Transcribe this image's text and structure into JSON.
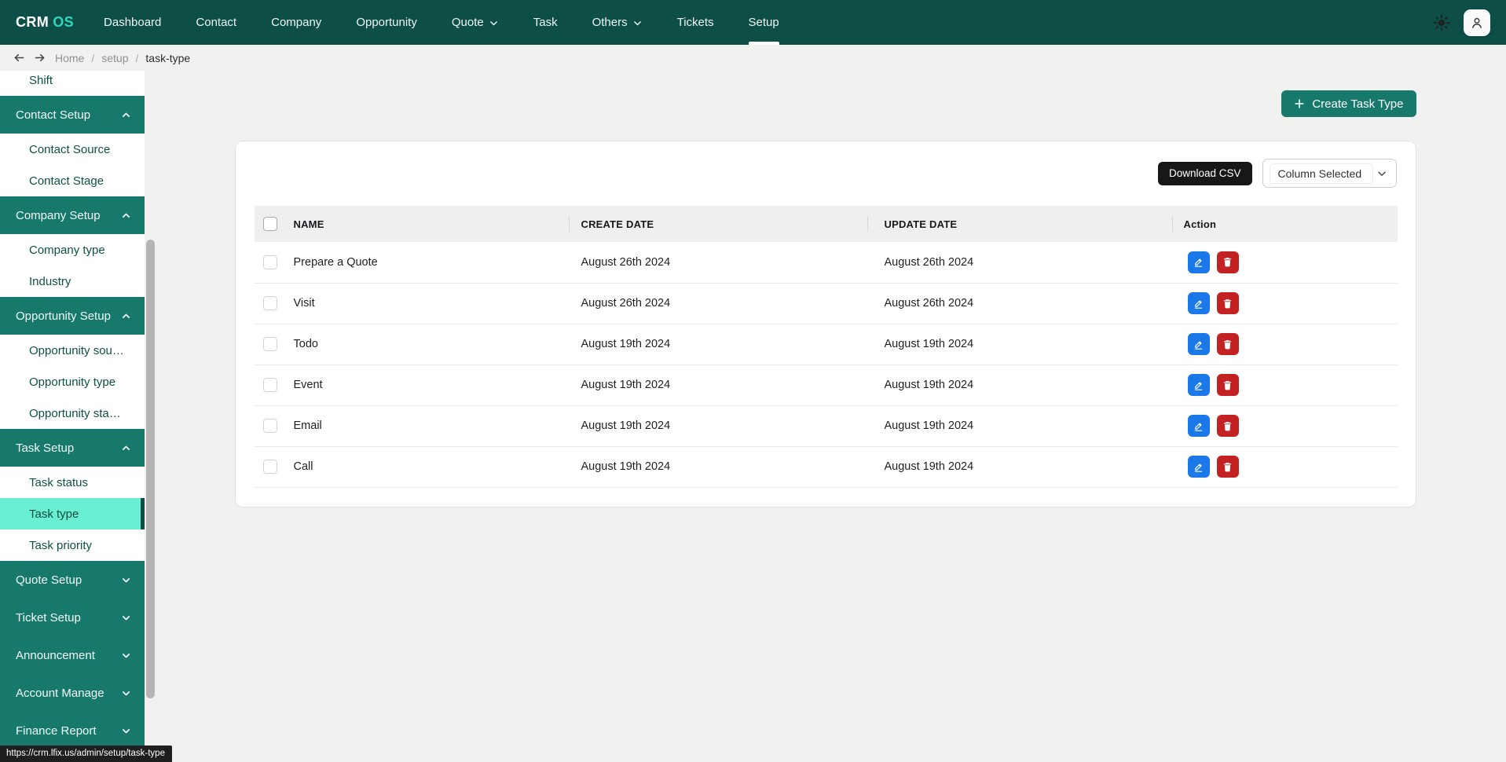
{
  "navbar": {
    "logo_primary": "CRM",
    "logo_accent": "OS",
    "items": [
      "Dashboard",
      "Contact",
      "Company",
      "Opportunity",
      "Quote",
      "Task",
      "Others",
      "Tickets",
      "Setup"
    ],
    "active_item": "Setup"
  },
  "breadcrumb": {
    "separator": "/",
    "items": [
      "Home",
      "setup",
      "task-type"
    ]
  },
  "sidebar": {
    "items": [
      {
        "label": "Shift",
        "type": "sub"
      },
      {
        "label": "Contact Setup",
        "type": "group",
        "state": "expanded"
      },
      {
        "label": "Contact Source",
        "type": "sub"
      },
      {
        "label": "Contact Stage",
        "type": "sub"
      },
      {
        "label": "Company Setup",
        "type": "group",
        "state": "expanded"
      },
      {
        "label": "Company type",
        "type": "sub"
      },
      {
        "label": "Industry",
        "type": "sub"
      },
      {
        "label": "Opportunity Setup",
        "type": "group",
        "state": "expanded"
      },
      {
        "label": "Opportunity sou…",
        "type": "sub"
      },
      {
        "label": "Opportunity type",
        "type": "sub"
      },
      {
        "label": "Opportunity sta…",
        "type": "sub"
      },
      {
        "label": "Task Setup",
        "type": "group",
        "state": "expanded"
      },
      {
        "label": "Task status",
        "type": "sub"
      },
      {
        "label": "Task type",
        "type": "sub",
        "active": true
      },
      {
        "label": "Task priority",
        "type": "sub"
      },
      {
        "label": "Quote Setup",
        "type": "group",
        "state": "collapsed"
      },
      {
        "label": "Ticket Setup",
        "type": "group",
        "state": "collapsed"
      },
      {
        "label": "Announcement",
        "type": "group",
        "state": "collapsed"
      },
      {
        "label": "Account Manage",
        "type": "group",
        "state": "collapsed"
      },
      {
        "label": "Finance Report",
        "type": "group",
        "state": "collapsed"
      }
    ]
  },
  "main": {
    "create_button": "Create Task Type",
    "toolbar": {
      "download_csv": "Download CSV",
      "column_selected": "Column Selected"
    },
    "table": {
      "headers": {
        "name": "NAME",
        "create_date": "CREATE DATE",
        "update_date": "UPDATE DATE",
        "action": "Action"
      },
      "rows": [
        {
          "name": "Prepare a Quote",
          "create_date": "August 26th 2024",
          "update_date": "August 26th 2024"
        },
        {
          "name": "Visit",
          "create_date": "August 26th 2024",
          "update_date": "August 26th 2024"
        },
        {
          "name": "Todo",
          "create_date": "August 19th 2024",
          "update_date": "August 19th 2024"
        },
        {
          "name": "Event",
          "create_date": "August 19th 2024",
          "update_date": "August 19th 2024"
        },
        {
          "name": "Email",
          "create_date": "August 19th 2024",
          "update_date": "August 19th 2024"
        },
        {
          "name": "Call",
          "create_date": "August 19th 2024",
          "update_date": "August 19th 2024"
        }
      ]
    }
  },
  "status_tooltip": {
    "url": "https://crm.lfix.us/admin/setup/task-type"
  },
  "icons": {
    "theme": "sun-icon",
    "profile": "user-icon",
    "nav_back": "arrow-left-icon",
    "nav_forward": "arrow-right-icon",
    "group_expanded": "chevron-up-icon",
    "group_collapsed": "chevron-down-icon",
    "edit": "pencil-icon",
    "delete": "trash-icon",
    "create": "plus-icon"
  },
  "colors": {
    "navbar_bg": "#0d4f47",
    "logo_accent": "#2cd8bd",
    "sidebar_group_bg": "#17796b",
    "active_item_bg": "#69efd2",
    "create_button_bg": "#17796b",
    "download_button_bg": "#161719",
    "edit_button_bg": "#1b78e9",
    "delete_button_bg": "#c32122",
    "page_bg": "#f1f1ef",
    "table_header_bg": "#edeff1"
  }
}
